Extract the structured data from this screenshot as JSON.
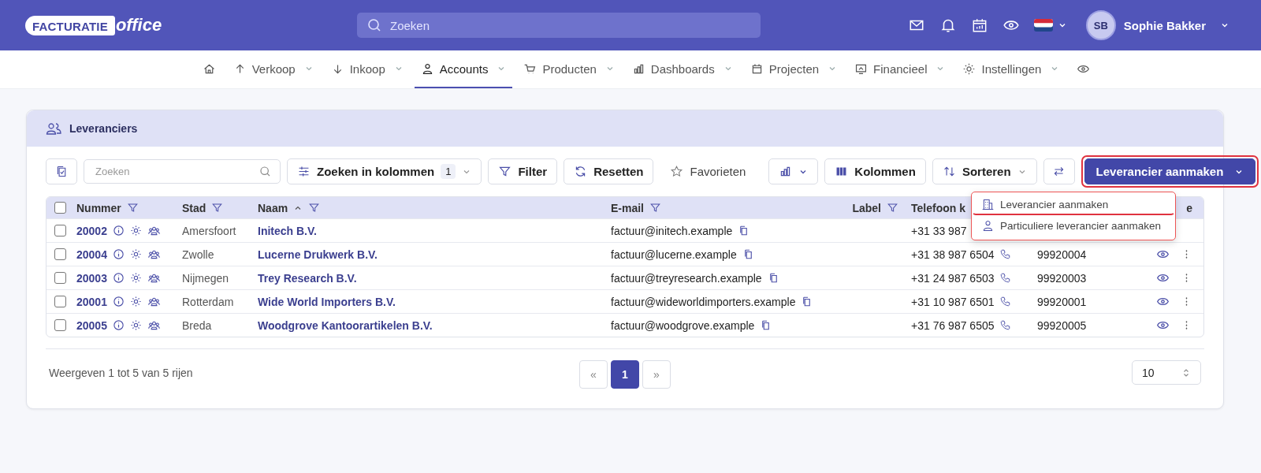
{
  "logo": {
    "word": "FACTURATIE",
    "suffix": "office"
  },
  "topbar": {
    "search_placeholder": "Zoeken",
    "user": {
      "initials": "SB",
      "name": "Sophie Bakker"
    }
  },
  "nav": [
    {
      "kind": "home",
      "selected": false
    },
    {
      "label": "Verkoop",
      "kind": "up",
      "selected": false
    },
    {
      "label": "Inkoop",
      "kind": "down",
      "selected": false
    },
    {
      "label": "Accounts",
      "kind": "user",
      "selected": true
    },
    {
      "label": "Producten",
      "kind": "cart",
      "selected": false
    },
    {
      "label": "Dashboards",
      "kind": "chart",
      "selected": false
    },
    {
      "label": "Projecten",
      "kind": "calendar",
      "selected": false
    },
    {
      "label": "Financieel",
      "kind": "monitor",
      "selected": false
    },
    {
      "label": "Instellingen",
      "kind": "gear",
      "selected": false
    },
    {
      "kind": "eye",
      "selected": false
    }
  ],
  "card": {
    "title": "Leveranciers"
  },
  "toolbar": {
    "search_placeholder": "Zoeken",
    "column_search": {
      "label": "Zoeken in kolommen",
      "count": "1"
    },
    "filter": "Filter",
    "reset": "Resetten",
    "favorites": "Favorieten",
    "columns": "Kolommen",
    "sort": "Sorteren",
    "create": {
      "label": "Leverancier aanmaken",
      "highlighted": true
    }
  },
  "create_menu": [
    {
      "label": "Leverancier aanmaken",
      "kind": "company",
      "highlighted": true
    },
    {
      "label": "Particuliere leverancier aanmaken",
      "kind": "person",
      "highlighted": false
    }
  ],
  "table": {
    "select_all_checked": false,
    "columns": [
      {
        "label": "Nummer",
        "filter": true,
        "sort": false
      },
      {
        "label": "Stad",
        "filter": true,
        "sort": false
      },
      {
        "label": "Naam",
        "filter": true,
        "sort": true
      },
      {
        "label": "E-mail",
        "filter": true,
        "sort": false
      },
      {
        "label": "Label",
        "filter": true,
        "sort": false
      },
      {
        "label": "Telefoon k"
      },
      {},
      {
        "label": "e"
      }
    ],
    "rows": [
      {
        "number": "20002",
        "city": "Amersfoort",
        "name": "Initech B.V.",
        "email": "factuur@initech.example",
        "phone": "+31 33 987",
        "checked": false
      },
      {
        "number": "20004",
        "city": "Zwolle",
        "name": "Lucerne Drukwerk B.V.",
        "email": "factuur@lucerne.example",
        "phone": "+31 38 987 6504",
        "code": "99920004",
        "checked": false
      },
      {
        "number": "20003",
        "city": "Nijmegen",
        "name": "Trey Research B.V.",
        "email": "factuur@treyresearch.example",
        "phone": "+31 24 987 6503",
        "code": "99920003",
        "checked": false
      },
      {
        "number": "20001",
        "city": "Rotterdam",
        "name": "Wide World Importers B.V.",
        "email": "factuur@wideworldimporters.example",
        "phone": "+31 10 987 6501",
        "code": "99920001",
        "checked": false
      },
      {
        "number": "20005",
        "city": "Breda",
        "name": "Woodgrove Kantoorartikelen B.V.",
        "email": "factuur@woodgrove.example",
        "phone": "+31 76 987 6505",
        "code": "99920005",
        "checked": false
      }
    ]
  },
  "footer": {
    "summary": "Weergeven 1 tot 5 van 5 rijen",
    "pages": [
      {
        "label": "«",
        "kind": "prev",
        "selected": false
      },
      {
        "label": "1",
        "kind": "page",
        "selected": true
      },
      {
        "label": "»",
        "kind": "next",
        "selected": false
      }
    ],
    "page_size": "10"
  }
}
